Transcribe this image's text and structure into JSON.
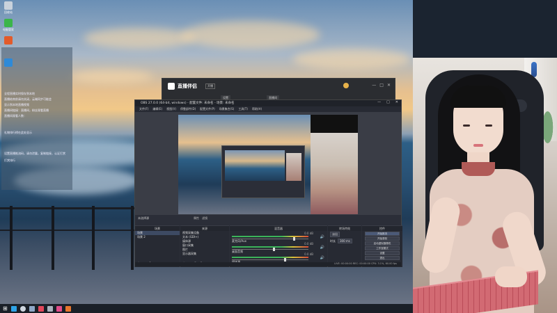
{
  "desktop": {
    "icons": [
      {
        "label": "回收站",
        "color": "#c9d2dc"
      },
      {
        "label": "电脑管家",
        "color": "#3bb54a"
      },
      {
        "label": "",
        "color": "#e25b2b"
      },
      {
        "label": "",
        "color": "#2e8ad8"
      },
      {
        "label": "",
        "color": "#4a6fd6"
      }
    ],
    "side_panel_lines": [
      "全程直播实时保存到本地",
      "直播结束前请勿关闭，云端同步可能会",
      "显示到本地直播视频",
      "直播间链接：直播间，粉丝观看直播",
      "直播间观看人数：",
      "礼物排行榜在此处显示",
      "设置直播推流码，请勿泄露，复制链接，认证打赏",
      "打赏排行"
    ]
  },
  "tool_window": {
    "brand": "直播伴侣",
    "tag": "开播",
    "tabs": [
      "",
      "设置",
      "直播间"
    ]
  },
  "obs": {
    "title": "OBS 27.0.0 (64-bit, windows) - 配置文件: 未命名 - 场景: 未命名",
    "menu": [
      "文件(F)",
      "编辑(E)",
      "视图(V)",
      "停靠部件(D)",
      "配置文件(P)",
      "场景集合(S)",
      "工具(T)",
      "帮助(H)"
    ],
    "scene_label": "未选择源",
    "props_buttons": [
      "属性",
      "滤镜"
    ],
    "docks": {
      "scenes": {
        "title": "场景",
        "items": [
          "场景",
          "场景 2"
        ]
      },
      "sources": {
        "title": "来源",
        "items": [
          "视频采集设备",
          "文本 (GDI+)",
          "媒体源",
          "窗口采集",
          "图片",
          "显示器采集"
        ]
      },
      "mixer": {
        "title": "混音器",
        "channels": [
          {
            "name": "麦克风/Aux",
            "db": "0.0 dB",
            "level": 0.82
          },
          {
            "name": "桌面音频",
            "db": "0.0 dB",
            "level": 0.55
          },
          {
            "name": "媒体源",
            "db": "0.0 dB",
            "level": 0.7
          }
        ]
      },
      "transitions": {
        "title": "转场特效",
        "type": "淡出",
        "duration_label": "时长",
        "duration": "300 ms"
      },
      "controls": {
        "title": "控件",
        "buttons": [
          "开始推流",
          "开始录制",
          "启动虚拟摄像机",
          "工作室模式",
          "设置",
          "退出"
        ]
      }
    },
    "status": "LIVE: 00:00:00   REC: 00:00:00   CPU: 3.1%, 60.00 fps"
  },
  "taskbar": {
    "icons": [
      {
        "name": "start",
        "color": "#ffffff"
      },
      {
        "name": "edge",
        "color": "#2fa3e6"
      },
      {
        "name": "search",
        "color": "#cfd6df"
      },
      {
        "name": "steam",
        "color": "#8fa7c6"
      },
      {
        "name": "app-red",
        "color": "#e2475b"
      },
      {
        "name": "app-grey",
        "color": "#aab2bd"
      },
      {
        "name": "app-pink",
        "color": "#e24c8b"
      },
      {
        "name": "app-orange",
        "color": "#e8762d"
      }
    ]
  },
  "colors": {
    "accent": "#4b5a78",
    "meter_green": "#3cb35a",
    "meter_red": "#d84a3a"
  }
}
